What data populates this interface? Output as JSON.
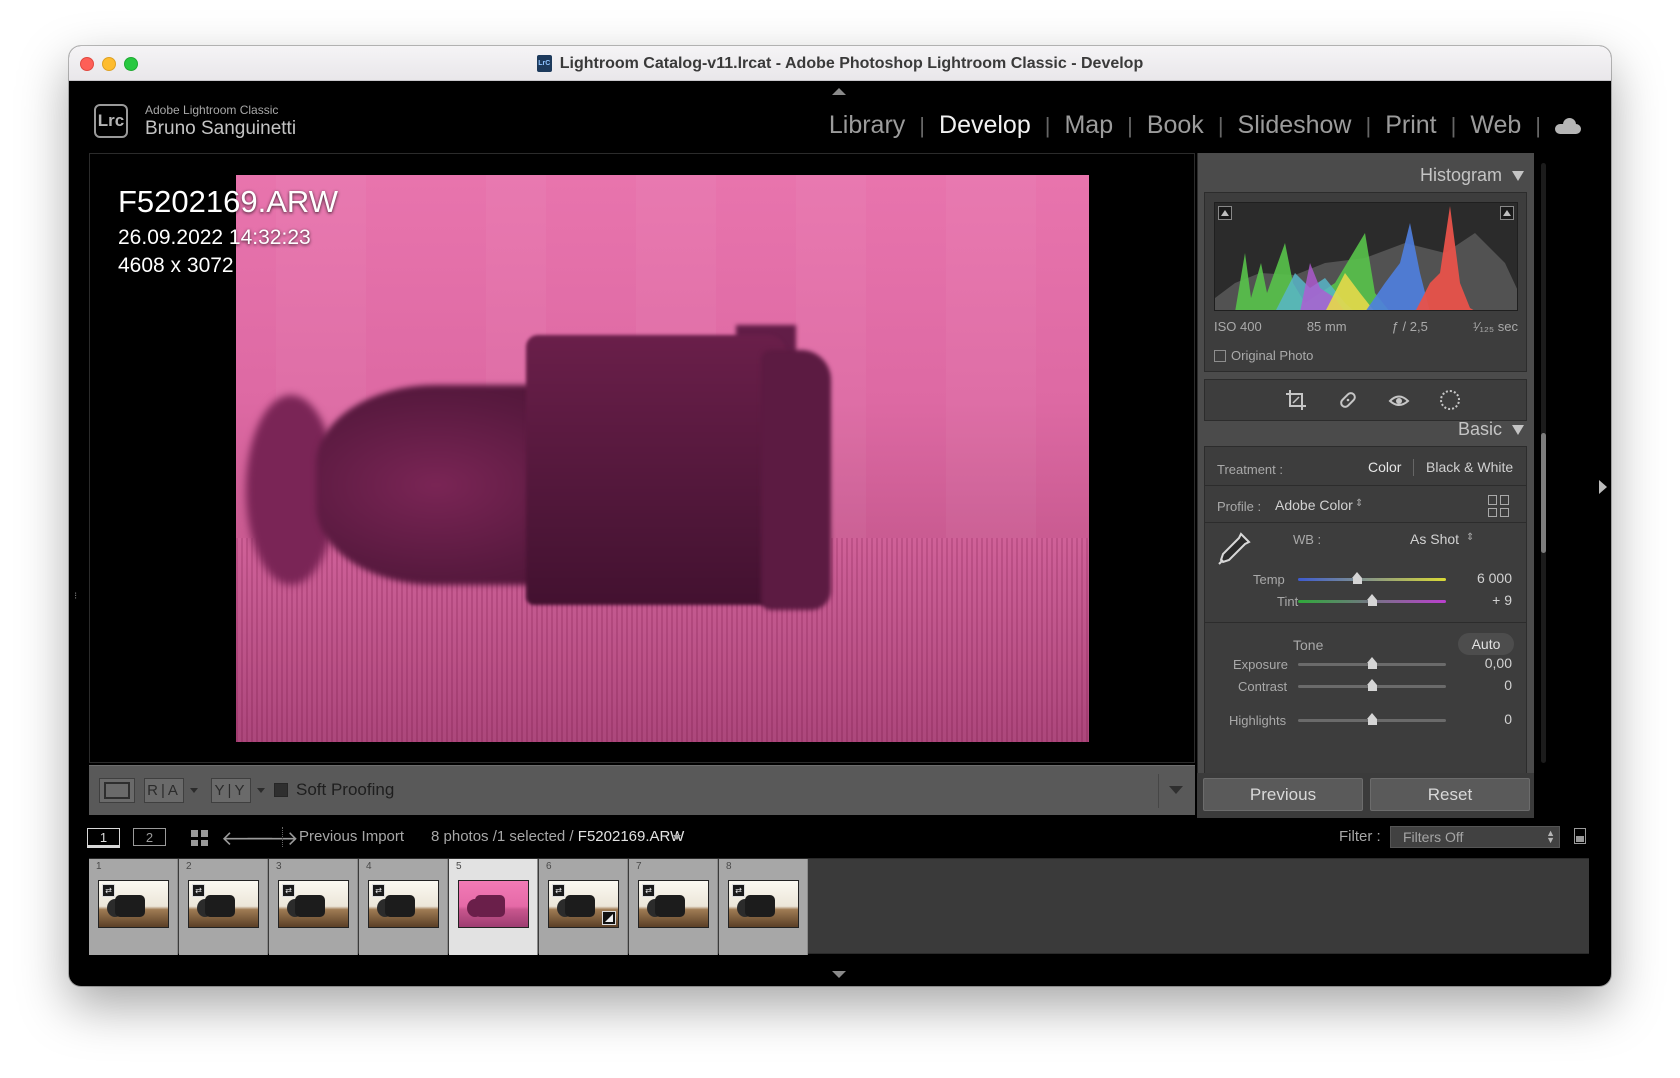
{
  "window": {
    "title": "Lightroom Catalog-v11.lrcat - Adobe Photoshop Lightroom Classic - Develop",
    "title_icon_label": "LrC"
  },
  "identity": {
    "logo": "Lrc",
    "app_name": "Adobe Lightroom Classic",
    "user_name": "Bruno Sanguinetti"
  },
  "modules": [
    {
      "label": "Library",
      "active": false
    },
    {
      "label": "Develop",
      "active": true
    },
    {
      "label": "Map",
      "active": false
    },
    {
      "label": "Book",
      "active": false
    },
    {
      "label": "Slideshow",
      "active": false
    },
    {
      "label": "Print",
      "active": false
    },
    {
      "label": "Web",
      "active": false
    }
  ],
  "cloud_icon": "cloud-icon",
  "photo_info": {
    "filename": "F5202169.ARW",
    "datetime": "26.09.2022 14:32:23",
    "dimensions": "4608 x 3072"
  },
  "toolbar": {
    "ra_label": "R|A",
    "yy_label": "Y|Y",
    "soft_proofing": "Soft Proofing",
    "soft_proofing_checked": false
  },
  "histogram": {
    "header": "Histogram",
    "iso": "ISO 400",
    "focal": "85 mm",
    "aperture": "ƒ / 2,5",
    "shutter": "¹⁄₁₂₅ sec",
    "original_photo": "Original Photo",
    "colors": {
      "red": "#e8524a",
      "green": "#58c34a",
      "blue": "#4f7fe0",
      "yellow": "#e6d94a",
      "cyan": "#58b5c8",
      "magenta": "#b25ad4",
      "gray": "#9a9a9a"
    }
  },
  "tools": [
    "crop-icon",
    "healing-icon",
    "red-eye-icon",
    "masking-icon"
  ],
  "basic": {
    "header": "Basic",
    "treatment_label": "Treatment :",
    "treatment_color": "Color",
    "treatment_bw": "Black & White",
    "profile_label": "Profile :",
    "profile_value": "Adobe Color",
    "wb_label": "WB :",
    "wb_value": "As Shot",
    "temp": {
      "label": "Temp",
      "value": "6 000",
      "position": 0.4
    },
    "tint": {
      "label": "Tint",
      "value": "+ 9",
      "position": 0.5
    },
    "tone_label": "Tone",
    "auto_label": "Auto",
    "exposure": {
      "label": "Exposure",
      "value": "0,00",
      "position": 0.5
    },
    "contrast": {
      "label": "Contrast",
      "value": "0",
      "position": 0.5
    },
    "highlights": {
      "label": "Highlights",
      "value": "0",
      "position": 0.5
    }
  },
  "panel_buttons": {
    "previous": "Previous",
    "reset": "Reset"
  },
  "filmstrip_bar": {
    "view1": "1",
    "view2": "2",
    "source": "Previous Import",
    "count": "8 photos /1 selected /",
    "current_file": "F5202169.ARW",
    "filter_label": "Filter :",
    "filter_value": "Filters Off"
  },
  "filmstrip": {
    "thumbnails": [
      {
        "num": "1",
        "selected": false,
        "pink": false,
        "edited_badge": false
      },
      {
        "num": "2",
        "selected": false,
        "pink": false,
        "edited_badge": false
      },
      {
        "num": "3",
        "selected": false,
        "pink": false,
        "edited_badge": false
      },
      {
        "num": "4",
        "selected": false,
        "pink": false,
        "edited_badge": false
      },
      {
        "num": "5",
        "selected": true,
        "pink": true,
        "edited_badge": false
      },
      {
        "num": "6",
        "selected": false,
        "pink": false,
        "edited_badge": true
      },
      {
        "num": "7",
        "selected": false,
        "pink": false,
        "edited_badge": false
      },
      {
        "num": "8",
        "selected": false,
        "pink": false,
        "edited_badge": false
      }
    ]
  }
}
